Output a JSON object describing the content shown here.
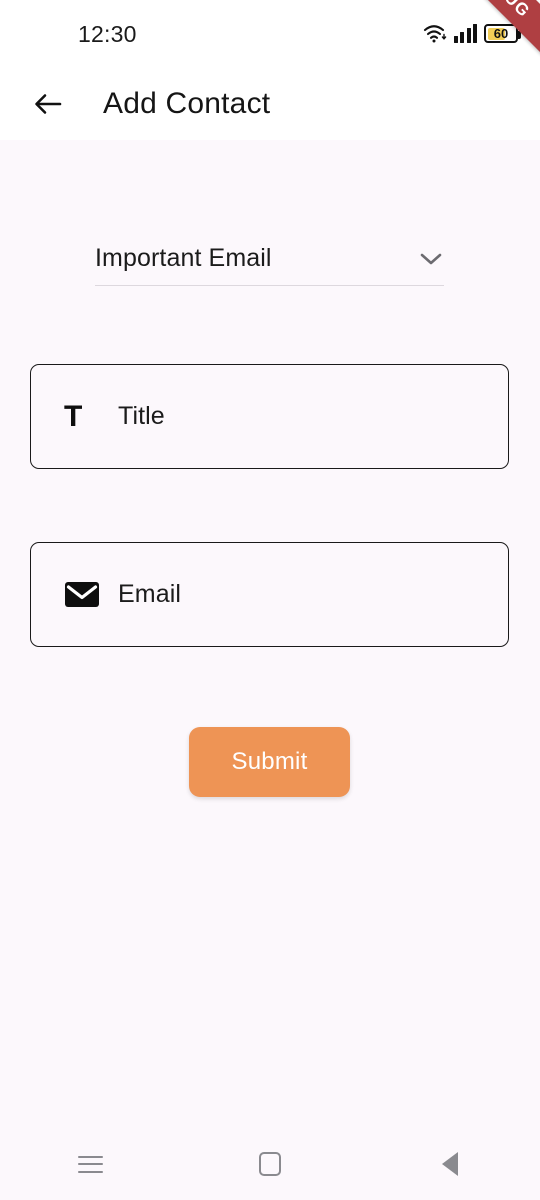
{
  "status_bar": {
    "time": "12:30",
    "wifi_icon": "wifi-icon",
    "signal_icon": "cellular-signal-icon",
    "battery_level": "60",
    "battery_icon": "battery-icon"
  },
  "debug_banner": {
    "label": "DEBUG",
    "color": "#AF3F42"
  },
  "app_bar": {
    "back_icon": "back-arrow-icon",
    "title": "Add Contact"
  },
  "form": {
    "category_dropdown": {
      "value": "Important Email",
      "chevron_icon": "chevron-down-icon"
    },
    "title_field": {
      "icon": "text-format-icon",
      "icon_glyph": "T",
      "placeholder": "Title",
      "value": ""
    },
    "email_field": {
      "icon": "envelope-icon",
      "placeholder": "Email",
      "value": ""
    },
    "submit_button": {
      "label": "Submit",
      "color": "#EE9455"
    }
  },
  "nav_bar": {
    "recents_icon": "recents-icon",
    "home_icon": "home-icon",
    "back_icon": "nav-back-icon"
  },
  "theme": {
    "background": "#FCF8FC",
    "appbar_background": "#FFFFFF",
    "accent": "#EE9455",
    "text": "#1B1B1B"
  }
}
